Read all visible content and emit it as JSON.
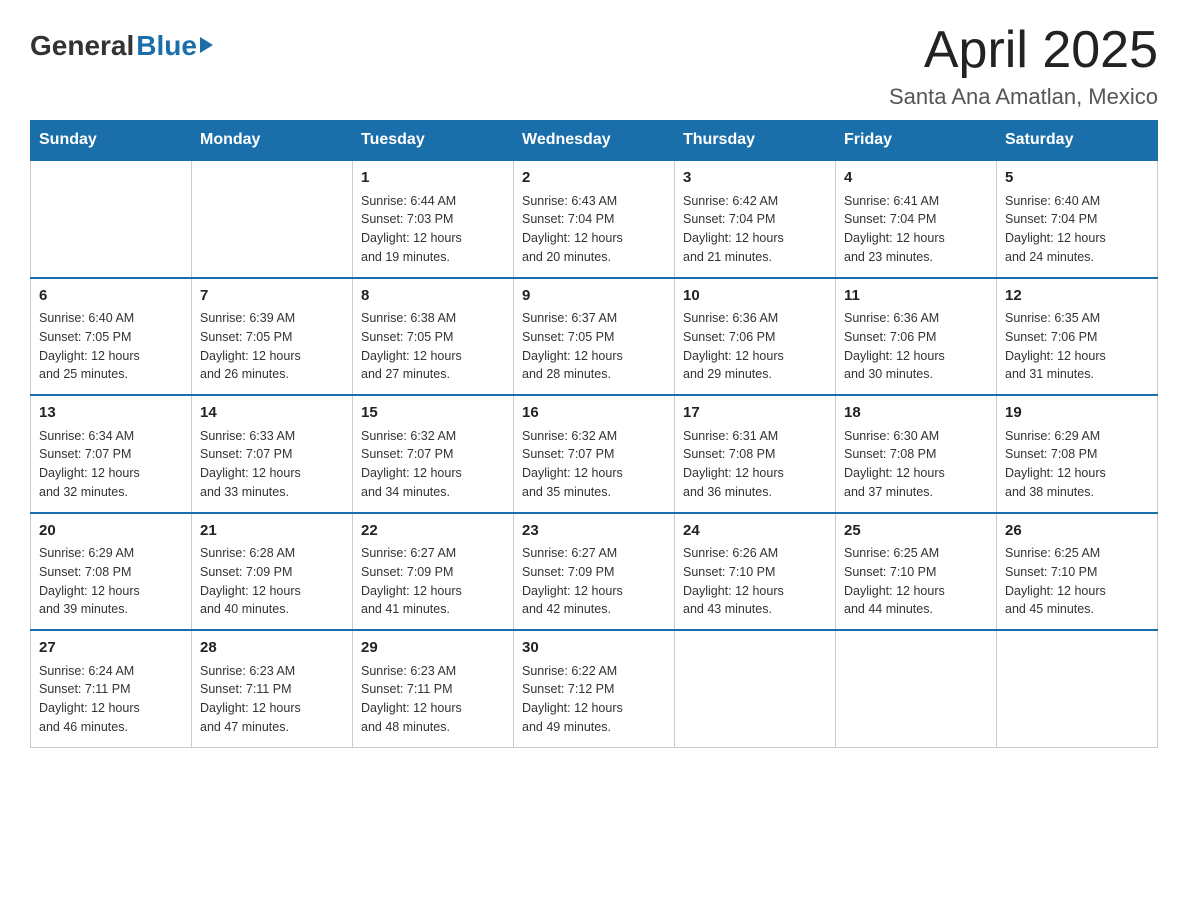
{
  "header": {
    "logo_general": "General",
    "logo_blue": "Blue",
    "month_title": "April 2025",
    "location": "Santa Ana Amatlan, Mexico"
  },
  "weekdays": [
    "Sunday",
    "Monday",
    "Tuesday",
    "Wednesday",
    "Thursday",
    "Friday",
    "Saturday"
  ],
  "weeks": [
    [
      {
        "day": "",
        "info": ""
      },
      {
        "day": "",
        "info": ""
      },
      {
        "day": "1",
        "info": "Sunrise: 6:44 AM\nSunset: 7:03 PM\nDaylight: 12 hours\nand 19 minutes."
      },
      {
        "day": "2",
        "info": "Sunrise: 6:43 AM\nSunset: 7:04 PM\nDaylight: 12 hours\nand 20 minutes."
      },
      {
        "day": "3",
        "info": "Sunrise: 6:42 AM\nSunset: 7:04 PM\nDaylight: 12 hours\nand 21 minutes."
      },
      {
        "day": "4",
        "info": "Sunrise: 6:41 AM\nSunset: 7:04 PM\nDaylight: 12 hours\nand 23 minutes."
      },
      {
        "day": "5",
        "info": "Sunrise: 6:40 AM\nSunset: 7:04 PM\nDaylight: 12 hours\nand 24 minutes."
      }
    ],
    [
      {
        "day": "6",
        "info": "Sunrise: 6:40 AM\nSunset: 7:05 PM\nDaylight: 12 hours\nand 25 minutes."
      },
      {
        "day": "7",
        "info": "Sunrise: 6:39 AM\nSunset: 7:05 PM\nDaylight: 12 hours\nand 26 minutes."
      },
      {
        "day": "8",
        "info": "Sunrise: 6:38 AM\nSunset: 7:05 PM\nDaylight: 12 hours\nand 27 minutes."
      },
      {
        "day": "9",
        "info": "Sunrise: 6:37 AM\nSunset: 7:05 PM\nDaylight: 12 hours\nand 28 minutes."
      },
      {
        "day": "10",
        "info": "Sunrise: 6:36 AM\nSunset: 7:06 PM\nDaylight: 12 hours\nand 29 minutes."
      },
      {
        "day": "11",
        "info": "Sunrise: 6:36 AM\nSunset: 7:06 PM\nDaylight: 12 hours\nand 30 minutes."
      },
      {
        "day": "12",
        "info": "Sunrise: 6:35 AM\nSunset: 7:06 PM\nDaylight: 12 hours\nand 31 minutes."
      }
    ],
    [
      {
        "day": "13",
        "info": "Sunrise: 6:34 AM\nSunset: 7:07 PM\nDaylight: 12 hours\nand 32 minutes."
      },
      {
        "day": "14",
        "info": "Sunrise: 6:33 AM\nSunset: 7:07 PM\nDaylight: 12 hours\nand 33 minutes."
      },
      {
        "day": "15",
        "info": "Sunrise: 6:32 AM\nSunset: 7:07 PM\nDaylight: 12 hours\nand 34 minutes."
      },
      {
        "day": "16",
        "info": "Sunrise: 6:32 AM\nSunset: 7:07 PM\nDaylight: 12 hours\nand 35 minutes."
      },
      {
        "day": "17",
        "info": "Sunrise: 6:31 AM\nSunset: 7:08 PM\nDaylight: 12 hours\nand 36 minutes."
      },
      {
        "day": "18",
        "info": "Sunrise: 6:30 AM\nSunset: 7:08 PM\nDaylight: 12 hours\nand 37 minutes."
      },
      {
        "day": "19",
        "info": "Sunrise: 6:29 AM\nSunset: 7:08 PM\nDaylight: 12 hours\nand 38 minutes."
      }
    ],
    [
      {
        "day": "20",
        "info": "Sunrise: 6:29 AM\nSunset: 7:08 PM\nDaylight: 12 hours\nand 39 minutes."
      },
      {
        "day": "21",
        "info": "Sunrise: 6:28 AM\nSunset: 7:09 PM\nDaylight: 12 hours\nand 40 minutes."
      },
      {
        "day": "22",
        "info": "Sunrise: 6:27 AM\nSunset: 7:09 PM\nDaylight: 12 hours\nand 41 minutes."
      },
      {
        "day": "23",
        "info": "Sunrise: 6:27 AM\nSunset: 7:09 PM\nDaylight: 12 hours\nand 42 minutes."
      },
      {
        "day": "24",
        "info": "Sunrise: 6:26 AM\nSunset: 7:10 PM\nDaylight: 12 hours\nand 43 minutes."
      },
      {
        "day": "25",
        "info": "Sunrise: 6:25 AM\nSunset: 7:10 PM\nDaylight: 12 hours\nand 44 minutes."
      },
      {
        "day": "26",
        "info": "Sunrise: 6:25 AM\nSunset: 7:10 PM\nDaylight: 12 hours\nand 45 minutes."
      }
    ],
    [
      {
        "day": "27",
        "info": "Sunrise: 6:24 AM\nSunset: 7:11 PM\nDaylight: 12 hours\nand 46 minutes."
      },
      {
        "day": "28",
        "info": "Sunrise: 6:23 AM\nSunset: 7:11 PM\nDaylight: 12 hours\nand 47 minutes."
      },
      {
        "day": "29",
        "info": "Sunrise: 6:23 AM\nSunset: 7:11 PM\nDaylight: 12 hours\nand 48 minutes."
      },
      {
        "day": "30",
        "info": "Sunrise: 6:22 AM\nSunset: 7:12 PM\nDaylight: 12 hours\nand 49 minutes."
      },
      {
        "day": "",
        "info": ""
      },
      {
        "day": "",
        "info": ""
      },
      {
        "day": "",
        "info": ""
      }
    ]
  ]
}
